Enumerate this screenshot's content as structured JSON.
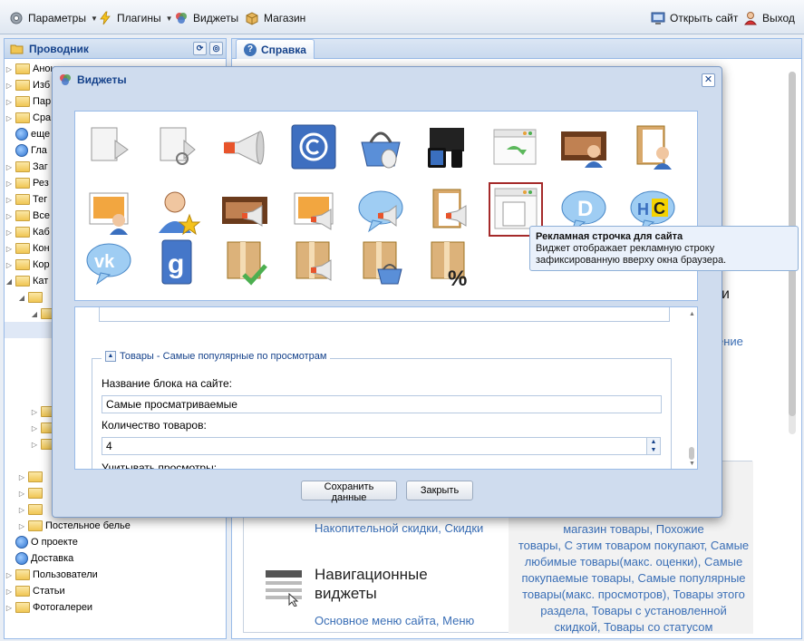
{
  "topbar": {
    "params": "Параметры",
    "plugins": "Плагины",
    "widgets": "Виджеты",
    "shop": "Магазин",
    "open_site": "Открыть сайт",
    "logout": "Выход"
  },
  "explorer": {
    "title": "Проводник",
    "items": [
      "Анонсы",
      "Изб",
      "Пар",
      "Сра",
      "еще",
      "Гла",
      "Заг",
      "Рез",
      "Тег",
      "Все",
      "Каб",
      "Кон",
      "Кор",
      "Кат",
      "",
      "",
      "",
      "",
      "",
      "",
      "",
      "Постельное белье",
      "О проекте",
      "Доставка",
      "Пользователи",
      "Статьи",
      "Фотогалереи"
    ]
  },
  "rightpanel": {
    "tab": "Справка",
    "frag_i": "и",
    "frag_ение": "ение",
    "accum": "Накопительной скидки, Скидки",
    "nav_title": "Навигационные виджеты",
    "nav_sub": "Основное меню сайта, Меню",
    "right_lines": [
      "магазин товары, Похожие",
      "товары, С этим товаром покупают, Самые",
      "любимые товары(макс. оценки), Самые",
      "покупаемые товары, Самые популярные",
      "товары(макс. просмотров), Товары этого",
      "раздела, Товары с установленной",
      "скидкой, Товары со статусом"
    ]
  },
  "modal": {
    "title": "Виджеты",
    "icons": [
      "document-arrow-icon",
      "document-link-icon",
      "megaphone-icon",
      "copyright-icon",
      "shopping-basket-icon",
      "devices-icon",
      "window-arrow-icon",
      "filmstrip-user-icon",
      "book-user-icon",
      "picture-user-icon",
      "user-star-icon",
      "filmstrip-megaphone-icon",
      "picture-megaphone-icon",
      "bubble-megaphone-icon",
      "book-megaphone-icon",
      "window-page-icon",
      "bubble-d-icon",
      "bubble-hc-icon",
      "vk-bubble-icon",
      "odnoklassniki-icon",
      "box-check-icon",
      "box-megaphone-icon",
      "box-basket-icon",
      "box-percent-icon"
    ],
    "tooltip": {
      "title": "Рекламная строчка для сайта",
      "text": "Виджет отображает рекламную строку зафиксированную вверху окна браузера."
    },
    "fieldset_legend": "Товары - Самые популярные по просмотрам",
    "block_name_label": "Название блока на сайте:",
    "block_name_value": "Самые просматриваемые",
    "count_label": "Количество товаров:",
    "count_value": "4",
    "views_label": "Учитывать просмотры:",
    "save_button": "Сохранить данные",
    "close_button": "Закрыть"
  }
}
